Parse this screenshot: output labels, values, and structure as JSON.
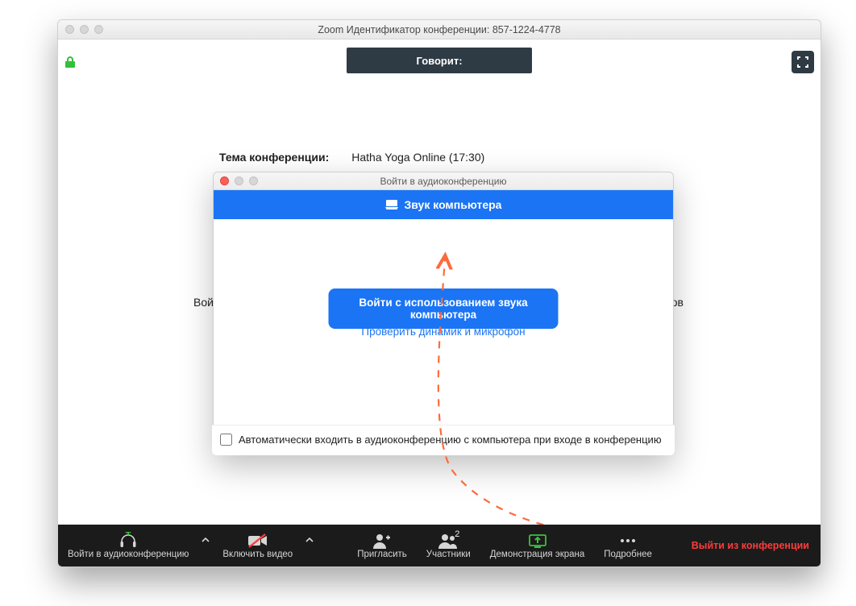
{
  "window": {
    "title": "Zoom Идентификатор конференции: 857-1224-4778",
    "speaking_label": "Говорит:"
  },
  "topic": {
    "label": "Тема конференции:",
    "value": "Hatha Yoga Online (17:30)"
  },
  "background": {
    "join_fragment": "Вой",
    "participants_fragment": "тников"
  },
  "modal": {
    "title": "Войти в аудиоконференцию",
    "tab_label": "Звук компьютера",
    "join_button": "Войти с использованием звука компьютера",
    "test_link": "Проверить динамик и микрофон",
    "auto_join_label": "Автоматически входить в аудиоконференцию с компьютера при входе в конференцию"
  },
  "toolbar": {
    "audio": "Войти в аудиоконференцию",
    "video": "Включить видео",
    "invite": "Пригласить",
    "participants": "Участники",
    "participants_count": "2",
    "share": "Демонстрация экрана",
    "more": "Подробнее",
    "leave": "Выйти из конференции"
  },
  "colors": {
    "accent": "#1b74f4",
    "toolbar_bg": "#1b1b1b",
    "share_green": "#39c23a",
    "lock_green": "#33c03a",
    "leave_red": "#ff3b3b",
    "arrow": "#ff6a3d"
  }
}
